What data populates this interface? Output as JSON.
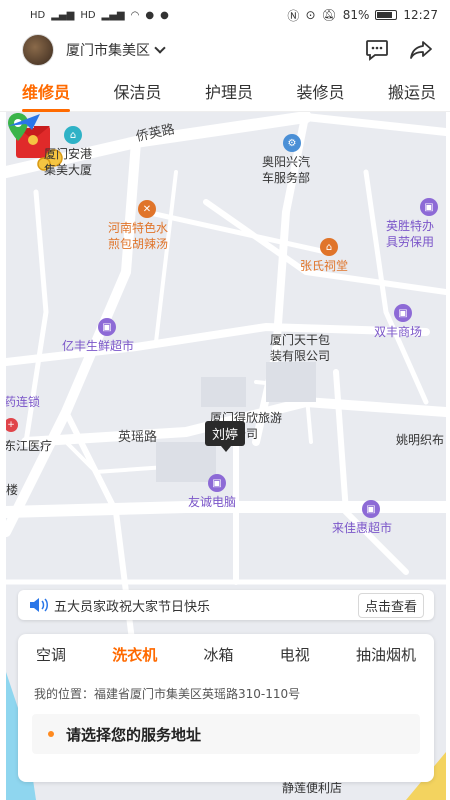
{
  "status_bar": {
    "left_labels": [
      "HD",
      "HD"
    ],
    "battery": "81%",
    "time": "12:27"
  },
  "header": {
    "city": "厦门市集美区"
  },
  "tabs": [
    "维修员",
    "保洁员",
    "护理员",
    "装修员",
    "搬运员"
  ],
  "map": {
    "road_labels": [
      "侨英路",
      "英瑶路"
    ],
    "pois": [
      {
        "name": "厦门安港集美大厦",
        "line1": "厦门安港",
        "line2": "集美大厦"
      },
      {
        "name": "奥阳兴汽车服务部",
        "line1": "奥阳兴汽",
        "line2": "车服务部"
      },
      {
        "name": "河南特色水煎包胡辣汤",
        "line1": "河南特色水",
        "line2": "煎包胡辣汤"
      },
      {
        "name": "英胜特办具劳保用",
        "line1": "英胜特办",
        "line2": "具劳保用"
      },
      {
        "name": "张氏祠堂",
        "line1": "张氏祠堂"
      },
      {
        "name": "亿丰生鲜超市",
        "line1": "亿丰生鲜超市"
      },
      {
        "name": "厦门天干包装有限公司",
        "line1": "厦门天干包",
        "line2": "装有限公司"
      },
      {
        "name": "双丰商场",
        "line1": "双丰商场"
      },
      {
        "name": "药连锁",
        "line1": "药连锁"
      },
      {
        "name": "东江医疗",
        "line1": "东江医疗"
      },
      {
        "name": "厦门得欣旅游有限公司",
        "line1": "厦门得欣旅游",
        "line2": "有限公司"
      },
      {
        "name": "姚明织布",
        "line1": "姚明织布"
      },
      {
        "name": "友诚电脑",
        "line1": "友诚电脑"
      },
      {
        "name": "来佳惠超市",
        "line1": "来佳惠超市"
      },
      {
        "name": "楼",
        "line1": "楼"
      },
      {
        "name": "静莲便利店",
        "line1": "静莲便利店"
      }
    ],
    "pin_label": "刘婷"
  },
  "notice": {
    "text": "五大员家政祝大家节日快乐",
    "button": "点击查看"
  },
  "panel": {
    "categories": [
      "空调",
      "洗衣机",
      "冰箱",
      "电视",
      "抽油烟机"
    ],
    "location_label": "我的位置：",
    "location_value": "福建省厦门市集美区英瑶路310-110号",
    "choose_address": "请选择您的服务地址"
  },
  "colors": {
    "accent": "#ff6a00",
    "map_bg": "#e9ebf0",
    "poi_purple": "#7b56c9",
    "poi_orange": "#e0742a",
    "pin_green": "#3bb44a"
  }
}
